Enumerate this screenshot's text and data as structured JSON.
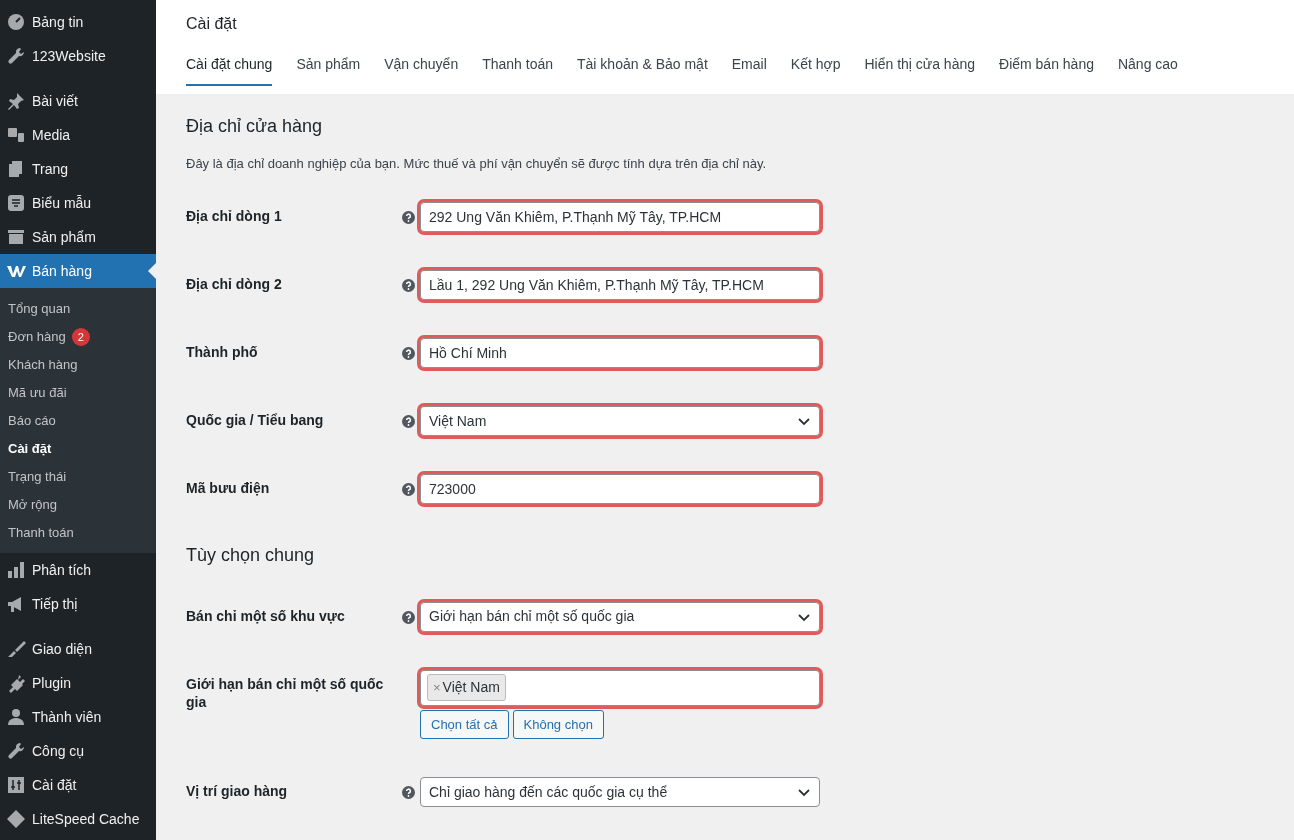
{
  "sidebar": {
    "groups": [
      [
        {
          "label": "Bảng tin",
          "selected": false
        },
        {
          "label": "123Website",
          "selected": false
        }
      ],
      [
        {
          "label": "Bài viết",
          "selected": false
        },
        {
          "label": "Media",
          "selected": false
        },
        {
          "label": "Trang",
          "selected": false
        },
        {
          "label": "Biểu mẫu",
          "selected": false
        },
        {
          "label": "Sản phẩm",
          "selected": false
        },
        {
          "label": "Bán hàng",
          "selected": true,
          "children": [
            {
              "label": "Tổng quan",
              "selected": false
            },
            {
              "label": "Đơn hàng",
              "selected": false,
              "badge": "2"
            },
            {
              "label": "Khách hàng",
              "selected": false
            },
            {
              "label": "Mã ưu đãi",
              "selected": false
            },
            {
              "label": "Báo cáo",
              "selected": false
            },
            {
              "label": "Cài đặt",
              "selected": true
            },
            {
              "label": "Trạng thái",
              "selected": false
            },
            {
              "label": "Mở rộng",
              "selected": false
            },
            {
              "label": "Thanh toán",
              "selected": false
            }
          ]
        },
        {
          "label": "Phân tích",
          "selected": false
        },
        {
          "label": "Tiếp thị",
          "selected": false
        }
      ],
      [
        {
          "label": "Giao diện",
          "selected": false
        },
        {
          "label": "Plugin",
          "selected": false
        },
        {
          "label": "Thành viên",
          "selected": false
        },
        {
          "label": "Công cụ",
          "selected": false
        },
        {
          "label": "Cài đặt",
          "selected": false
        },
        {
          "label": "LiteSpeed Cache",
          "selected": false
        }
      ]
    ]
  },
  "page": {
    "title": "Cài đặt"
  },
  "tabs": [
    {
      "label": "Cài đặt chung",
      "selected": true
    },
    {
      "label": "Sản phẩm",
      "selected": false
    },
    {
      "label": "Vận chuyển",
      "selected": false
    },
    {
      "label": "Thanh toán",
      "selected": false
    },
    {
      "label": "Tài khoản & Bảo mật",
      "selected": false
    },
    {
      "label": "Email",
      "selected": false
    },
    {
      "label": "Kết hợp",
      "selected": false
    },
    {
      "label": "Hiển thị cửa hàng",
      "selected": false
    },
    {
      "label": "Điểm bán hàng",
      "selected": false
    },
    {
      "label": "Nâng cao",
      "selected": false
    }
  ],
  "sections": [
    {
      "title": "Địa chỉ cửa hàng",
      "description": "Đây là địa chỉ doanh nghiệp của bạn. Mức thuế và phí vận chuyển sẽ được tính dựa trên địa chỉ này.",
      "fields": [
        {
          "label": "Địa chỉ dòng 1",
          "kind": "text",
          "help": true,
          "highlighted": true,
          "value": "292 Ung Văn Khiêm, P.Thạnh Mỹ Tây, TP.HCM"
        },
        {
          "label": "Địa chỉ dòng 2",
          "kind": "text",
          "help": true,
          "highlighted": true,
          "value": "Lầu 1, 292 Ung Văn Khiêm, P.Thạnh Mỹ Tây, TP.HCM"
        },
        {
          "label": "Thành phố",
          "kind": "text",
          "help": true,
          "highlighted": true,
          "value": "Hồ Chí Minh"
        },
        {
          "label": "Quốc gia / Tiểu bang",
          "kind": "select",
          "help": true,
          "highlighted": true,
          "value": "Việt Nam"
        },
        {
          "label": "Mã bưu điện",
          "kind": "text",
          "help": true,
          "highlighted": true,
          "value": "723000"
        }
      ]
    },
    {
      "title": "Tùy chọn chung",
      "fields": [
        {
          "label": "Bán chỉ một số khu vực",
          "kind": "select",
          "help": true,
          "highlighted": true,
          "value": "Giới hạn bán chỉ một số quốc gia"
        },
        {
          "label": "Giới hạn bán chỉ một số quốc gia",
          "kind": "multiselect",
          "help": false,
          "highlighted": true,
          "tags": [
            {
              "remove": "×",
              "label": "Việt Nam"
            }
          ],
          "buttons": [
            "Chọn tất cả",
            "Không chọn"
          ]
        },
        {
          "label": "Vị trí giao hàng",
          "kind": "select",
          "help": true,
          "highlighted": false,
          "value": "Chỉ giao hàng đến các quốc gia cụ thể"
        }
      ]
    }
  ]
}
